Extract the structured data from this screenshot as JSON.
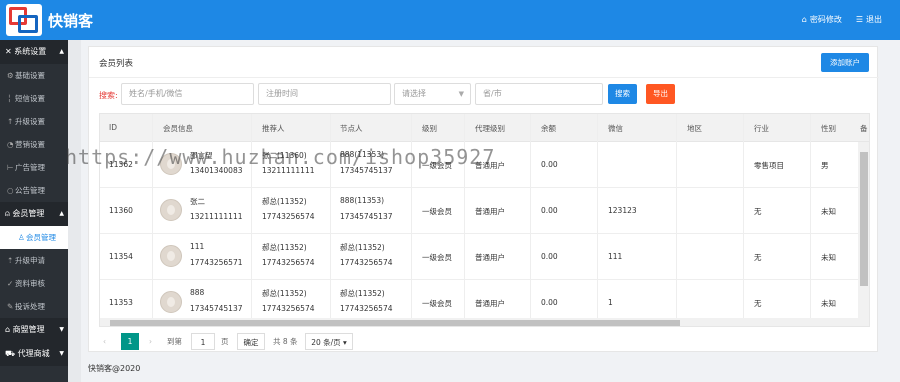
{
  "app": {
    "title": "快销客"
  },
  "header": {
    "change_password": "密码修改",
    "logout": "退出"
  },
  "sidebar": {
    "groups": [
      {
        "label": "系统设置",
        "items": [
          "基础设置",
          "短信设置",
          "升级设置",
          "营销设置",
          "广告管理",
          "公告管理"
        ]
      },
      {
        "label": "会员管理",
        "items": [
          "会员管理",
          "升级申请",
          "资料审核",
          "投诉处理"
        ]
      },
      {
        "label": "商盟管理",
        "items": []
      },
      {
        "label": "代理商城",
        "items": []
      }
    ]
  },
  "main": {
    "title": "会员列表",
    "add_button": "添加账户",
    "search": {
      "label": "搜索:",
      "name_placeholder": "姓名/手机/微信",
      "time_placeholder": "注册时间",
      "select_placeholder": "请选择",
      "city_placeholder": "省/市",
      "search_button": "搜索",
      "export_button": "导出"
    },
    "table": {
      "columns": [
        "ID",
        "会员信息",
        "推荐人",
        "节点人",
        "级别",
        "代理级别",
        "余额",
        "微信",
        "地区",
        "行业",
        "性别",
        "备"
      ],
      "rows": [
        {
          "id": "11362",
          "name": "邵言望",
          "phone": "13401340083",
          "ref_name": "张二(11360)",
          "ref_phone": "13211111111",
          "node_name": "888(11353)",
          "node_phone": "17345745137",
          "level": "一级会员",
          "agent": "普通用户",
          "balance": "0.00",
          "wechat": "",
          "region": "",
          "industry": "零售项目",
          "gender": "男"
        },
        {
          "id": "11360",
          "name": "张二",
          "phone": "13211111111",
          "ref_name": "郝总(11352)",
          "ref_phone": "17743256574",
          "node_name": "888(11353)",
          "node_phone": "17345745137",
          "level": "一级会员",
          "agent": "普通用户",
          "balance": "0.00",
          "wechat": "123123",
          "region": "",
          "industry": "无",
          "gender": "未知"
        },
        {
          "id": "11354",
          "name": "111",
          "phone": "17743256571",
          "ref_name": "郝总(11352)",
          "ref_phone": "17743256574",
          "node_name": "郝总(11352)",
          "node_phone": "17743256574",
          "level": "一级会员",
          "agent": "普通用户",
          "balance": "0.00",
          "wechat": "111",
          "region": "",
          "industry": "无",
          "gender": "未知"
        },
        {
          "id": "11353",
          "name": "888",
          "phone": "17345745137",
          "ref_name": "郝总(11352)",
          "ref_phone": "17743256574",
          "node_name": "郝总(11352)",
          "node_phone": "17743256574",
          "level": "一级会员",
          "agent": "普通用户",
          "balance": "0.00",
          "wechat": "1",
          "region": "",
          "industry": "无",
          "gender": "未知"
        }
      ]
    },
    "pagination": {
      "current_page": "1",
      "goto_label": "到第",
      "goto_value": "1",
      "page_unit": "页",
      "confirm": "确定",
      "total": "共 8 条",
      "per_page": "20 条/页"
    }
  },
  "watermark": "https://www.huzhan.com/ishop35927",
  "footer": {
    "copyright": "快销客@2020"
  }
}
